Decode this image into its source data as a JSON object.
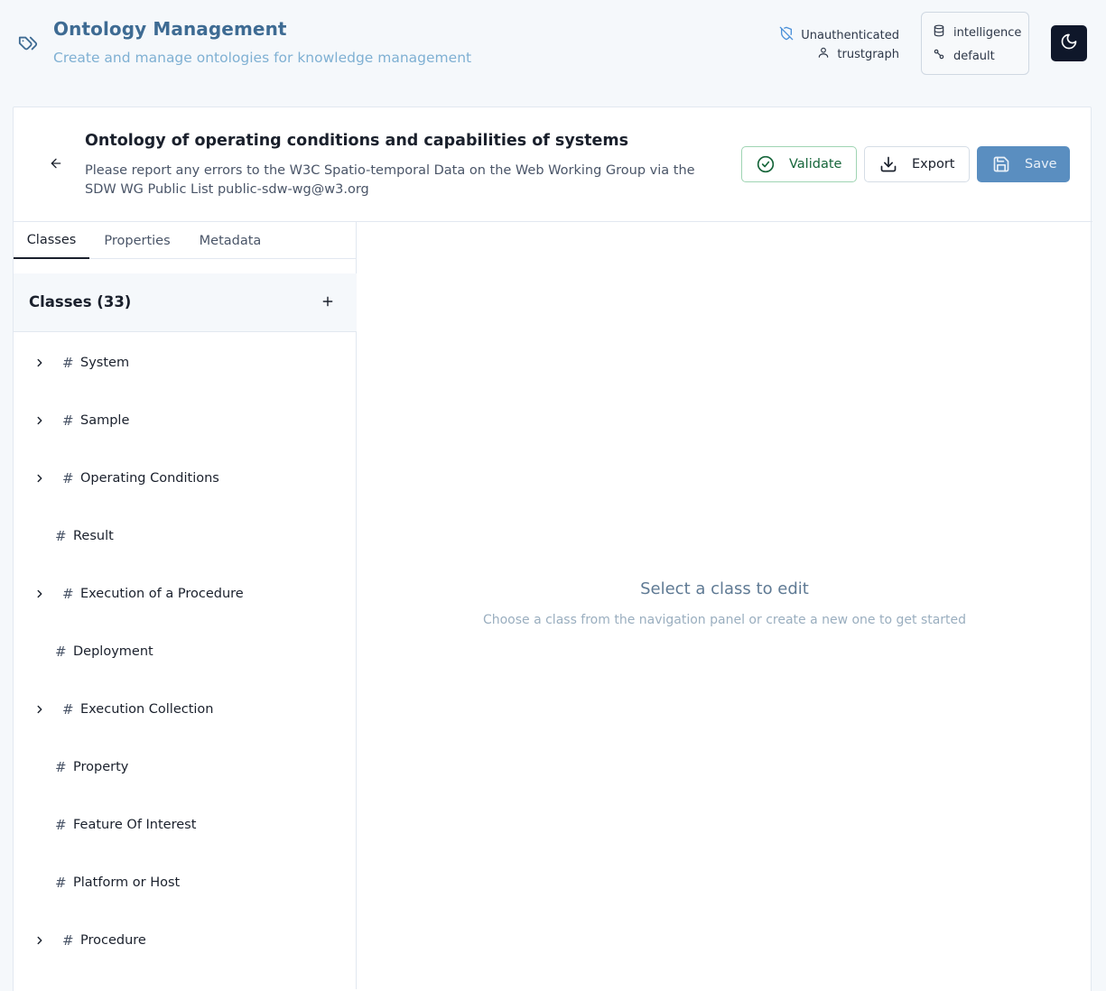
{
  "header": {
    "title": "Ontology Management",
    "subtitle": "Create and manage ontologies for knowledge management",
    "auth_status": "Unauthenticated",
    "user": "trustgraph",
    "workspace": "intelligence",
    "collection": "default"
  },
  "ontology": {
    "title": "Ontology of operating conditions and capabilities of systems",
    "description": "Please report any errors to the W3C Spatio-temporal Data on the Web Working Group via the SDW WG Public List public-sdw-wg@w3.org"
  },
  "actions": {
    "validate": "Validate",
    "export": "Export",
    "save": "Save"
  },
  "tabs": [
    {
      "label": "Classes",
      "active": true
    },
    {
      "label": "Properties",
      "active": false
    },
    {
      "label": "Metadata",
      "active": false
    }
  ],
  "classes_panel": {
    "title": "Classes (33)",
    "items": [
      {
        "label": "System",
        "expandable": true
      },
      {
        "label": "Sample",
        "expandable": true
      },
      {
        "label": "Operating Conditions",
        "expandable": true
      },
      {
        "label": "Result",
        "expandable": false
      },
      {
        "label": "Execution of a Procedure",
        "expandable": true
      },
      {
        "label": "Deployment",
        "expandable": false
      },
      {
        "label": "Execution Collection",
        "expandable": true
      },
      {
        "label": "Property",
        "expandable": false
      },
      {
        "label": "Feature Of Interest",
        "expandable": false
      },
      {
        "label": "Platform or Host",
        "expandable": false
      },
      {
        "label": "Procedure",
        "expandable": true
      }
    ]
  },
  "editor": {
    "empty_title": "Select a class to edit",
    "empty_subtitle": "Choose a class from the navigation panel or create a new one to get started"
  },
  "colors": {
    "accent": "#3e6b93",
    "save_button": "#5a8ec0",
    "validate_border": "#9fd4b3"
  },
  "icons": {
    "logo": "tags-icon",
    "auth": "shield-off-icon",
    "user": "user-icon",
    "workspace": "database-icon",
    "collection": "link-icon",
    "theme": "moon-icon",
    "back": "arrow-left-icon",
    "validate": "check-circle-icon",
    "export": "download-icon",
    "save": "save-icon",
    "add": "plus-icon",
    "expand": "chevron-right-icon",
    "class": "hash-icon"
  }
}
